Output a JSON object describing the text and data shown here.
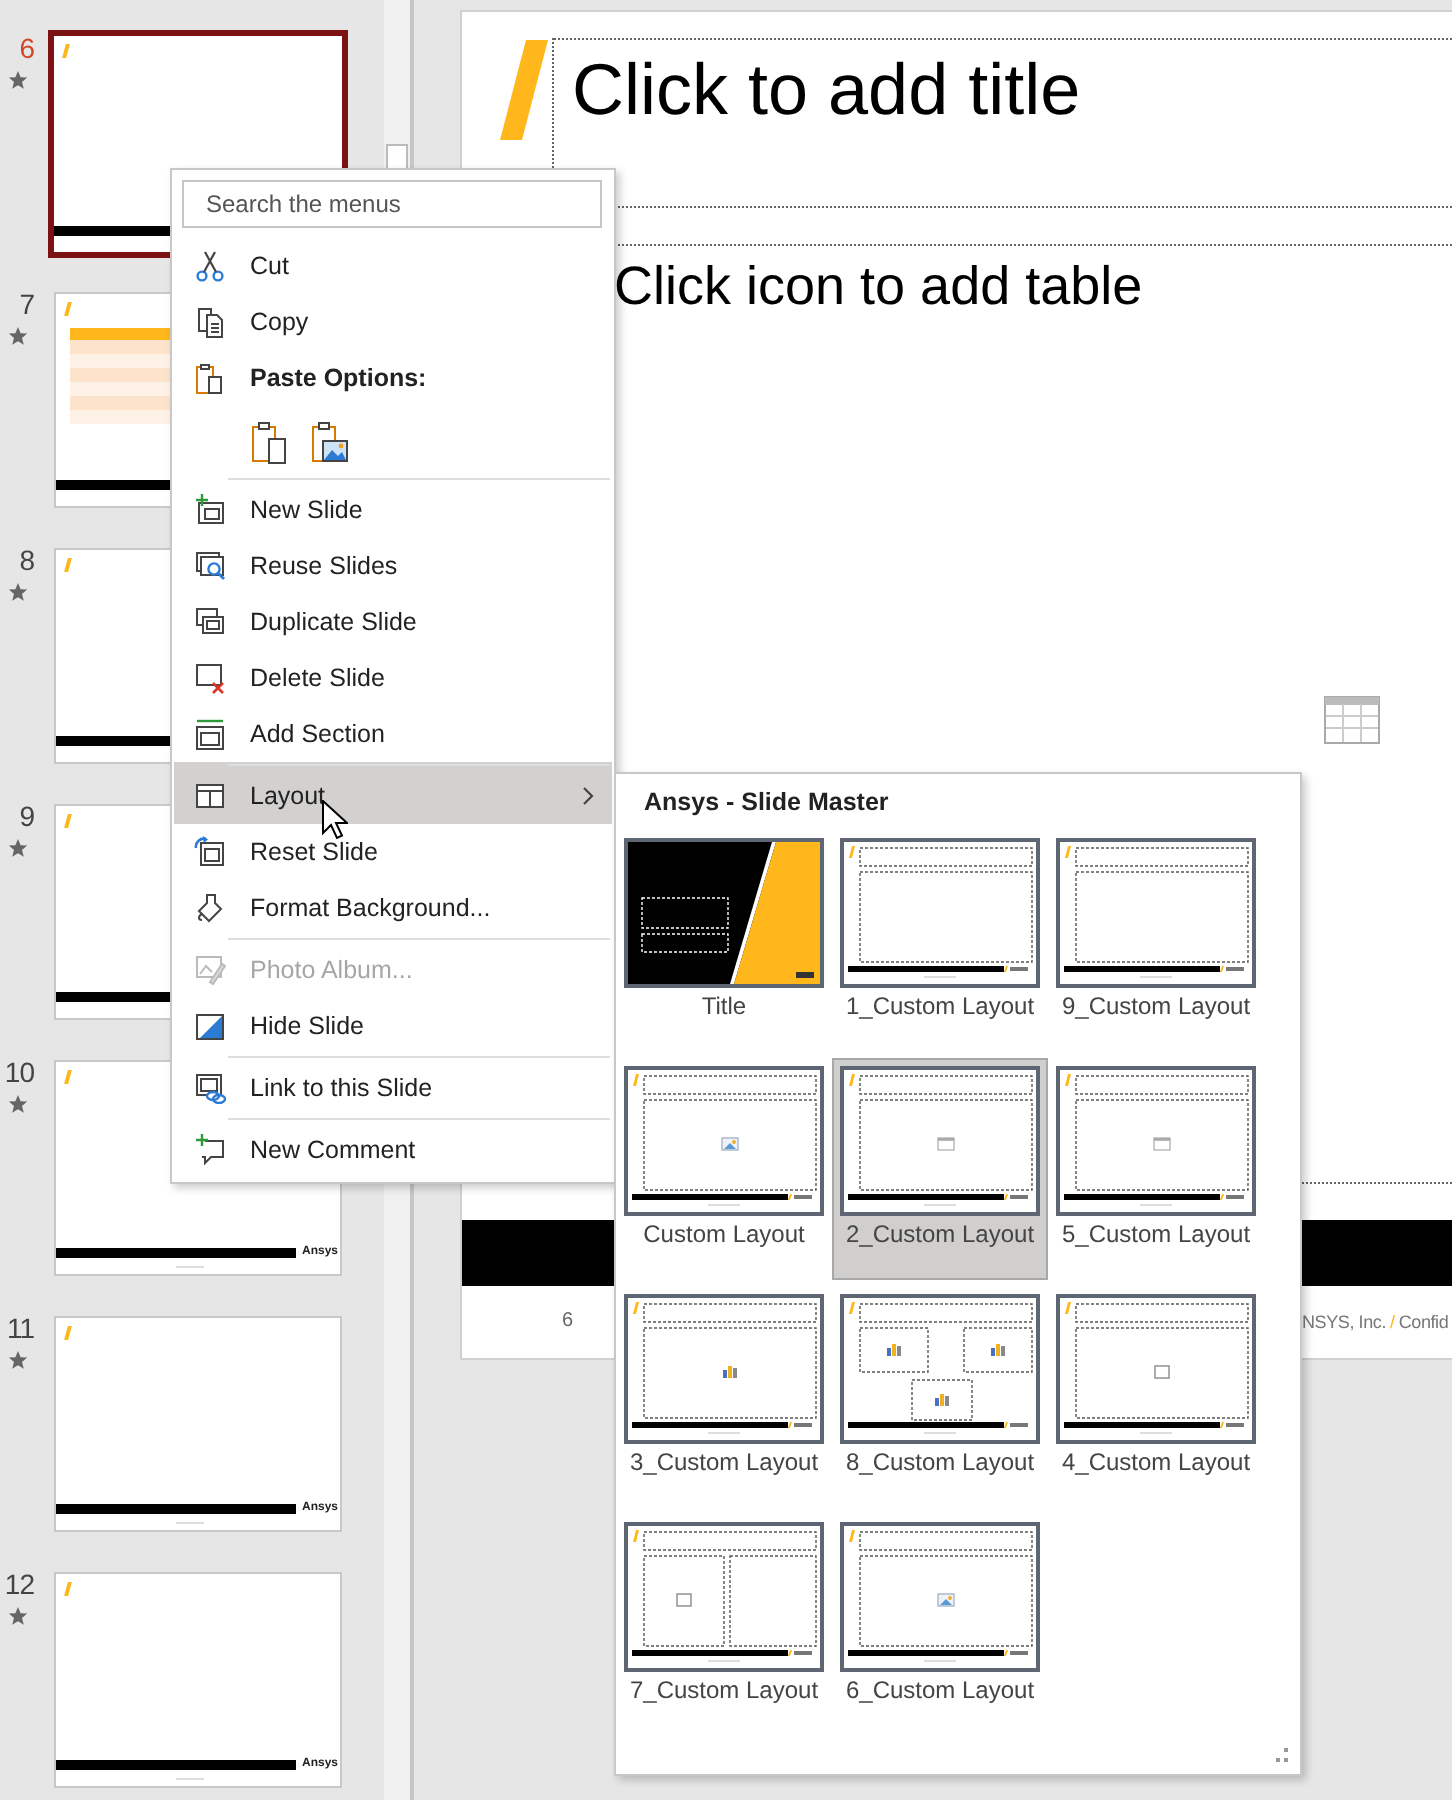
{
  "slides_pane": {
    "slides": [
      {
        "number": "6",
        "selected": true,
        "transition": true,
        "kind": "blank"
      },
      {
        "number": "7",
        "selected": false,
        "transition": true,
        "kind": "table"
      },
      {
        "number": "8",
        "selected": false,
        "transition": true,
        "kind": "blank"
      },
      {
        "number": "9",
        "selected": false,
        "transition": true,
        "kind": "blank"
      },
      {
        "number": "10",
        "selected": false,
        "transition": true,
        "kind": "blank",
        "logo": "Ansys"
      },
      {
        "number": "11",
        "selected": false,
        "transition": true,
        "kind": "blank",
        "logo": "Ansys"
      },
      {
        "number": "12",
        "selected": false,
        "transition": true,
        "kind": "blank",
        "logo": "Ansys"
      }
    ]
  },
  "slide": {
    "title_placeholder": "Click to add title",
    "body_placeholder": "Click icon to add table",
    "slide_number": "6",
    "footer_text": "NSYS, Inc.",
    "footer_separator": "/",
    "footer_text_2": "Confid"
  },
  "context_menu": {
    "search": {
      "placeholder": "Search the menus"
    },
    "items": [
      {
        "kind": "command",
        "label": "Cut",
        "selected": false,
        "disabled": false,
        "submenu": false,
        "separator_before": false
      },
      {
        "kind": "command",
        "label": "Copy",
        "selected": false,
        "disabled": false,
        "submenu": false,
        "separator_before": false
      },
      {
        "kind": "header",
        "label": "Paste Options:",
        "separator_before": false
      },
      {
        "kind": "paste-buttons",
        "separator_before": false
      },
      {
        "kind": "command",
        "label": "New Slide",
        "selected": false,
        "disabled": false,
        "submenu": false,
        "separator_before": true
      },
      {
        "kind": "command",
        "label": "Reuse Slides",
        "selected": false,
        "disabled": false,
        "submenu": false,
        "separator_before": false
      },
      {
        "kind": "command",
        "label": "Duplicate Slide",
        "selected": false,
        "disabled": false,
        "submenu": false,
        "separator_before": false
      },
      {
        "kind": "command",
        "label": "Delete Slide",
        "selected": false,
        "disabled": false,
        "submenu": false,
        "separator_before": false
      },
      {
        "kind": "command",
        "label": "Add Section",
        "selected": false,
        "disabled": false,
        "submenu": false,
        "separator_before": false
      },
      {
        "kind": "command",
        "label": "Layout",
        "selected": true,
        "disabled": false,
        "submenu": true,
        "separator_before": true
      },
      {
        "kind": "command",
        "label": "Reset Slide",
        "selected": false,
        "disabled": false,
        "submenu": false,
        "separator_before": false
      },
      {
        "kind": "command",
        "label": "Format Background...",
        "selected": false,
        "disabled": false,
        "submenu": false,
        "separator_before": false
      },
      {
        "kind": "command",
        "label": "Photo Album...",
        "selected": false,
        "disabled": true,
        "submenu": false,
        "separator_before": true
      },
      {
        "kind": "command",
        "label": "Hide Slide",
        "selected": false,
        "disabled": false,
        "submenu": false,
        "separator_before": false
      },
      {
        "kind": "command",
        "label": "Link to this Slide",
        "selected": false,
        "disabled": false,
        "submenu": false,
        "separator_before": true
      },
      {
        "kind": "command",
        "label": "New Comment",
        "selected": false,
        "disabled": false,
        "submenu": false,
        "separator_before": true
      }
    ]
  },
  "layout_submenu": {
    "title": "Ansys - Slide Master",
    "layouts": [
      {
        "name": "Title",
        "kind": "title",
        "selected": false
      },
      {
        "name": "1_Custom Layout",
        "kind": "blank",
        "selected": false
      },
      {
        "name": "9_Custom Layout",
        "kind": "blank",
        "selected": false
      },
      {
        "name": "Custom Layout",
        "kind": "picture",
        "selected": false
      },
      {
        "name": "2_Custom Layout",
        "kind": "table",
        "selected": true
      },
      {
        "name": "5_Custom Layout",
        "kind": "table",
        "selected": false
      },
      {
        "name": "3_Custom Layout",
        "kind": "chart",
        "selected": false
      },
      {
        "name": "8_Custom Layout",
        "kind": "three-chart",
        "selected": false
      },
      {
        "name": "4_Custom Layout",
        "kind": "media",
        "selected": false
      },
      {
        "name": "7_Custom Layout",
        "kind": "two-content",
        "selected": false
      },
      {
        "name": "6_Custom Layout",
        "kind": "picture",
        "selected": false
      }
    ]
  }
}
